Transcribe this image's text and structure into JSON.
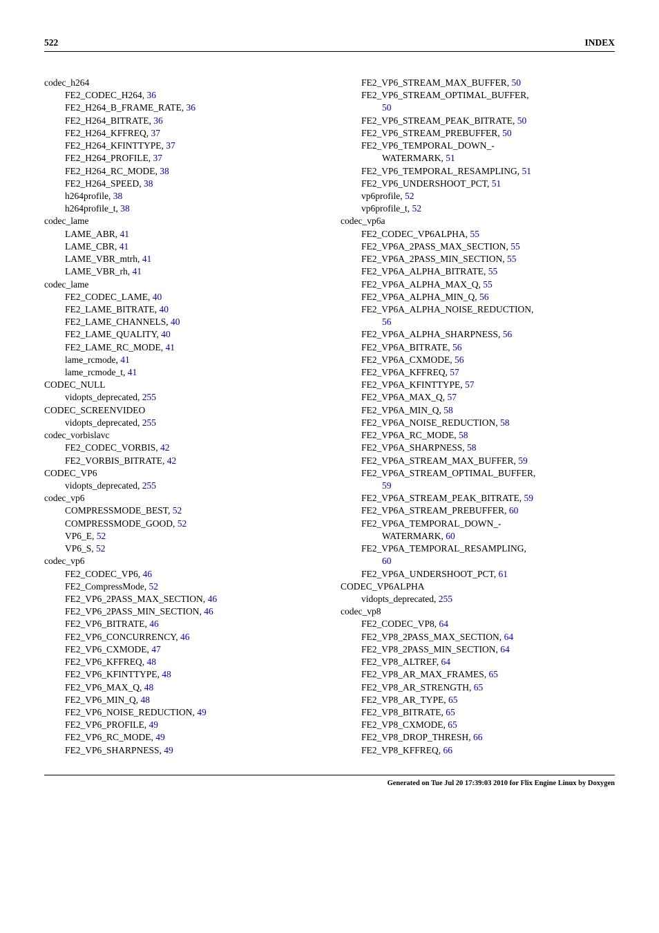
{
  "header": {
    "page_number": "522",
    "title": "INDEX"
  },
  "footer": "Generated on Tue Jul 20 17:39:03 2010 for Flix Engine Linux by Doxygen",
  "left": [
    {
      "t": "codec_h264",
      "l": 0
    },
    {
      "t": "FE2_CODEC_H264, ",
      "p": "36",
      "l": 1
    },
    {
      "t": "FE2_H264_B_FRAME_RATE, ",
      "p": "36",
      "l": 1
    },
    {
      "t": "FE2_H264_BITRATE, ",
      "p": "36",
      "l": 1
    },
    {
      "t": "FE2_H264_KFFREQ, ",
      "p": "37",
      "l": 1
    },
    {
      "t": "FE2_H264_KFINTTYPE, ",
      "p": "37",
      "l": 1
    },
    {
      "t": "FE2_H264_PROFILE, ",
      "p": "37",
      "l": 1
    },
    {
      "t": "FE2_H264_RC_MODE, ",
      "p": "38",
      "l": 1
    },
    {
      "t": "FE2_H264_SPEED, ",
      "p": "38",
      "l": 1
    },
    {
      "t": "h264profile, ",
      "p": "38",
      "l": 1
    },
    {
      "t": "h264profile_t, ",
      "p": "38",
      "l": 1
    },
    {
      "t": "codec_lame",
      "l": 0
    },
    {
      "t": "LAME_ABR, ",
      "p": "41",
      "l": 1
    },
    {
      "t": "LAME_CBR, ",
      "p": "41",
      "l": 1
    },
    {
      "t": "LAME_VBR_mtrh, ",
      "p": "41",
      "l": 1
    },
    {
      "t": "LAME_VBR_rh, ",
      "p": "41",
      "l": 1
    },
    {
      "t": "codec_lame",
      "l": 0
    },
    {
      "t": "FE2_CODEC_LAME, ",
      "p": "40",
      "l": 1
    },
    {
      "t": "FE2_LAME_BITRATE, ",
      "p": "40",
      "l": 1
    },
    {
      "t": "FE2_LAME_CHANNELS, ",
      "p": "40",
      "l": 1
    },
    {
      "t": "FE2_LAME_QUALITY, ",
      "p": "40",
      "l": 1
    },
    {
      "t": "FE2_LAME_RC_MODE, ",
      "p": "41",
      "l": 1
    },
    {
      "t": "lame_rcmode, ",
      "p": "41",
      "l": 1
    },
    {
      "t": "lame_rcmode_t, ",
      "p": "41",
      "l": 1
    },
    {
      "t": "CODEC_NULL",
      "l": 0
    },
    {
      "t": "vidopts_deprecated, ",
      "p": "255",
      "l": 1
    },
    {
      "t": "CODEC_SCREENVIDEO",
      "l": 0
    },
    {
      "t": "vidopts_deprecated, ",
      "p": "255",
      "l": 1
    },
    {
      "t": "codec_vorbislavc",
      "l": 0
    },
    {
      "t": "FE2_CODEC_VORBIS, ",
      "p": "42",
      "l": 1
    },
    {
      "t": "FE2_VORBIS_BITRATE, ",
      "p": "42",
      "l": 1
    },
    {
      "t": "CODEC_VP6",
      "l": 0
    },
    {
      "t": "vidopts_deprecated, ",
      "p": "255",
      "l": 1
    },
    {
      "t": "codec_vp6",
      "l": 0
    },
    {
      "t": "COMPRESSMODE_BEST, ",
      "p": "52",
      "l": 1
    },
    {
      "t": "COMPRESSMODE_GOOD, ",
      "p": "52",
      "l": 1
    },
    {
      "t": "VP6_E, ",
      "p": "52",
      "l": 1
    },
    {
      "t": "VP6_S, ",
      "p": "52",
      "l": 1
    },
    {
      "t": "codec_vp6",
      "l": 0
    },
    {
      "t": "FE2_CODEC_VP6, ",
      "p": "46",
      "l": 1
    },
    {
      "t": "FE2_CompressMode, ",
      "p": "52",
      "l": 1
    },
    {
      "t": "FE2_VP6_2PASS_MAX_SECTION, ",
      "p": "46",
      "l": 1
    },
    {
      "t": "FE2_VP6_2PASS_MIN_SECTION, ",
      "p": "46",
      "l": 1
    },
    {
      "t": "FE2_VP6_BITRATE, ",
      "p": "46",
      "l": 1
    },
    {
      "t": "FE2_VP6_CONCURRENCY, ",
      "p": "46",
      "l": 1
    },
    {
      "t": "FE2_VP6_CXMODE, ",
      "p": "47",
      "l": 1
    },
    {
      "t": "FE2_VP6_KFFREQ, ",
      "p": "48",
      "l": 1
    },
    {
      "t": "FE2_VP6_KFINTTYPE, ",
      "p": "48",
      "l": 1
    },
    {
      "t": "FE2_VP6_MAX_Q, ",
      "p": "48",
      "l": 1
    },
    {
      "t": "FE2_VP6_MIN_Q, ",
      "p": "48",
      "l": 1
    },
    {
      "t": "FE2_VP6_NOISE_REDUCTION, ",
      "p": "49",
      "l": 1
    },
    {
      "t": "FE2_VP6_PROFILE, ",
      "p": "49",
      "l": 1
    },
    {
      "t": "FE2_VP6_RC_MODE, ",
      "p": "49",
      "l": 1
    },
    {
      "t": "FE2_VP6_SHARPNESS, ",
      "p": "49",
      "l": 1
    }
  ],
  "right": [
    {
      "t": "FE2_VP6_STREAM_MAX_BUFFER, ",
      "p": "50",
      "l": 1
    },
    {
      "t": "FE2_VP6_STREAM_OPTIMAL_BUFFER,",
      "l": 1
    },
    {
      "p": "50",
      "l": 2
    },
    {
      "t": "FE2_VP6_STREAM_PEAK_BITRATE, ",
      "p": "50",
      "l": 1
    },
    {
      "t": "FE2_VP6_STREAM_PREBUFFER, ",
      "p": "50",
      "l": 1
    },
    {
      "t": "FE2_VP6_TEMPORAL_DOWN_-",
      "l": 1
    },
    {
      "t": "WATERMARK, ",
      "p": "51",
      "l": 2
    },
    {
      "t": "FE2_VP6_TEMPORAL_RESAMPLING, ",
      "p": "51",
      "l": 1
    },
    {
      "t": "FE2_VP6_UNDERSHOOT_PCT, ",
      "p": "51",
      "l": 1
    },
    {
      "t": "vp6profile, ",
      "p": "52",
      "l": 1
    },
    {
      "t": "vp6profile_t, ",
      "p": "52",
      "l": 1
    },
    {
      "t": "codec_vp6a",
      "l": 0
    },
    {
      "t": "FE2_CODEC_VP6ALPHA, ",
      "p": "55",
      "l": 1
    },
    {
      "t": "FE2_VP6A_2PASS_MAX_SECTION, ",
      "p": "55",
      "l": 1
    },
    {
      "t": "FE2_VP6A_2PASS_MIN_SECTION, ",
      "p": "55",
      "l": 1
    },
    {
      "t": "FE2_VP6A_ALPHA_BITRATE, ",
      "p": "55",
      "l": 1
    },
    {
      "t": "FE2_VP6A_ALPHA_MAX_Q, ",
      "p": "55",
      "l": 1
    },
    {
      "t": "FE2_VP6A_ALPHA_MIN_Q, ",
      "p": "56",
      "l": 1
    },
    {
      "t": "FE2_VP6A_ALPHA_NOISE_REDUCTION,",
      "l": 1
    },
    {
      "p": "56",
      "l": 2
    },
    {
      "t": "FE2_VP6A_ALPHA_SHARPNESS, ",
      "p": "56",
      "l": 1
    },
    {
      "t": "FE2_VP6A_BITRATE, ",
      "p": "56",
      "l": 1
    },
    {
      "t": "FE2_VP6A_CXMODE, ",
      "p": "56",
      "l": 1
    },
    {
      "t": "FE2_VP6A_KFFREQ, ",
      "p": "57",
      "l": 1
    },
    {
      "t": "FE2_VP6A_KFINTTYPE, ",
      "p": "57",
      "l": 1
    },
    {
      "t": "FE2_VP6A_MAX_Q, ",
      "p": "57",
      "l": 1
    },
    {
      "t": "FE2_VP6A_MIN_Q, ",
      "p": "58",
      "l": 1
    },
    {
      "t": "FE2_VP6A_NOISE_REDUCTION, ",
      "p": "58",
      "l": 1
    },
    {
      "t": "FE2_VP6A_RC_MODE, ",
      "p": "58",
      "l": 1
    },
    {
      "t": "FE2_VP6A_SHARPNESS, ",
      "p": "58",
      "l": 1
    },
    {
      "t": "FE2_VP6A_STREAM_MAX_BUFFER, ",
      "p": "59",
      "l": 1
    },
    {
      "t": "FE2_VP6A_STREAM_OPTIMAL_BUFFER,",
      "l": 1
    },
    {
      "p": "59",
      "l": 2
    },
    {
      "t": "FE2_VP6A_STREAM_PEAK_BITRATE, ",
      "p": "59",
      "l": 1
    },
    {
      "t": "FE2_VP6A_STREAM_PREBUFFER, ",
      "p": "60",
      "l": 1
    },
    {
      "t": "FE2_VP6A_TEMPORAL_DOWN_-",
      "l": 1
    },
    {
      "t": "WATERMARK, ",
      "p": "60",
      "l": 2
    },
    {
      "t": "FE2_VP6A_TEMPORAL_RESAMPLING,",
      "l": 1
    },
    {
      "p": "60",
      "l": 2
    },
    {
      "t": "FE2_VP6A_UNDERSHOOT_PCT, ",
      "p": "61",
      "l": 1
    },
    {
      "t": "CODEC_VP6ALPHA",
      "l": 0
    },
    {
      "t": "vidopts_deprecated, ",
      "p": "255",
      "l": 1
    },
    {
      "t": "codec_vp8",
      "l": 0
    },
    {
      "t": "FE2_CODEC_VP8, ",
      "p": "64",
      "l": 1
    },
    {
      "t": "FE2_VP8_2PASS_MAX_SECTION, ",
      "p": "64",
      "l": 1
    },
    {
      "t": "FE2_VP8_2PASS_MIN_SECTION, ",
      "p": "64",
      "l": 1
    },
    {
      "t": "FE2_VP8_ALTREF, ",
      "p": "64",
      "l": 1
    },
    {
      "t": "FE2_VP8_AR_MAX_FRAMES, ",
      "p": "65",
      "l": 1
    },
    {
      "t": "FE2_VP8_AR_STRENGTH, ",
      "p": "65",
      "l": 1
    },
    {
      "t": "FE2_VP8_AR_TYPE, ",
      "p": "65",
      "l": 1
    },
    {
      "t": "FE2_VP8_BITRATE, ",
      "p": "65",
      "l": 1
    },
    {
      "t": "FE2_VP8_CXMODE, ",
      "p": "65",
      "l": 1
    },
    {
      "t": "FE2_VP8_DROP_THRESH, ",
      "p": "66",
      "l": 1
    },
    {
      "t": "FE2_VP8_KFFREQ, ",
      "p": "66",
      "l": 1
    }
  ]
}
